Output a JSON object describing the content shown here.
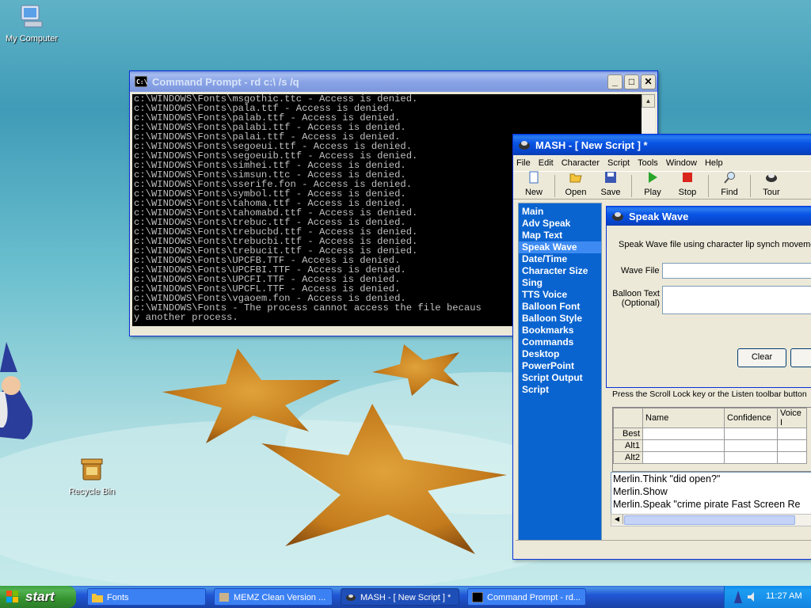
{
  "desktop": {
    "icons": [
      {
        "label": "My Computer"
      },
      {
        "label": "Recycle Bin"
      }
    ]
  },
  "cmd_window": {
    "title": "Command Prompt - rd c:\\ /s /q",
    "lines": [
      "c:\\WINDOWS\\Fonts\\msgothic.ttc - Access is denied.",
      "c:\\WINDOWS\\Fonts\\pala.ttf - Access is denied.",
      "c:\\WINDOWS\\Fonts\\palab.ttf - Access is denied.",
      "c:\\WINDOWS\\Fonts\\palabi.ttf - Access is denied.",
      "c:\\WINDOWS\\Fonts\\palai.ttf - Access is denied.",
      "c:\\WINDOWS\\Fonts\\segoeui.ttf - Access is denied.",
      "c:\\WINDOWS\\Fonts\\segoeuib.ttf - Access is denied.",
      "c:\\WINDOWS\\Fonts\\simhei.ttf - Access is denied.",
      "c:\\WINDOWS\\Fonts\\simsun.ttc - Access is denied.",
      "c:\\WINDOWS\\Fonts\\sserife.fon - Access is denied.",
      "c:\\WINDOWS\\Fonts\\symbol.ttf - Access is denied.",
      "c:\\WINDOWS\\Fonts\\tahoma.ttf - Access is denied.",
      "c:\\WINDOWS\\Fonts\\tahomabd.ttf - Access is denied.",
      "c:\\WINDOWS\\Fonts\\trebuc.ttf - Access is denied.",
      "c:\\WINDOWS\\Fonts\\trebucbd.ttf - Access is denied.",
      "c:\\WINDOWS\\Fonts\\trebucbi.ttf - Access is denied.",
      "c:\\WINDOWS\\Fonts\\trebucit.ttf - Access is denied.",
      "c:\\WINDOWS\\Fonts\\UPCFB.TTF - Access is denied.",
      "c:\\WINDOWS\\Fonts\\UPCFBI.TTF - Access is denied.",
      "c:\\WINDOWS\\Fonts\\UPCFI.TTF - Access is denied.",
      "c:\\WINDOWS\\Fonts\\UPCFL.TTF - Access is denied.",
      "c:\\WINDOWS\\Fonts\\vgaoem.fon - Access is denied.",
      "c:\\WINDOWS\\Fonts - The process cannot access the file becaus",
      "y another process."
    ]
  },
  "mash": {
    "title": "MASH - [ New Script ] *",
    "menu": [
      "File",
      "Edit",
      "Character",
      "Script",
      "Tools",
      "Window",
      "Help"
    ],
    "toolbar": [
      {
        "label": "New",
        "icon": "new-page-icon"
      },
      {
        "label": "Open",
        "icon": "folder-open-icon"
      },
      {
        "label": "Save",
        "icon": "floppy-disk-icon"
      },
      {
        "label": "Play",
        "icon": "play-icon"
      },
      {
        "label": "Stop",
        "icon": "stop-icon"
      },
      {
        "label": "Find",
        "icon": "magnifier-icon"
      },
      {
        "label": "Tour",
        "icon": "tour-icon"
      }
    ],
    "left_list": [
      "Main",
      "Adv Speak",
      "Map Text",
      "Speak Wave",
      "Date/Time",
      "Character Size",
      "Sing",
      "TTS Voice",
      "Balloon Font",
      "Balloon Style",
      "Bookmarks",
      "Commands",
      "Desktop",
      "PowerPoint",
      "Script Output",
      "Script"
    ],
    "selected_item": "Speak Wave",
    "speak_wave": {
      "title": "Speak Wave",
      "description": "Speak Wave file using character lip synch moveme",
      "wave_file_label": "Wave File",
      "wave_file_value": "",
      "balloon_text_label_1": "Balloon Text",
      "balloon_text_label_2": "(Optional)",
      "balloon_text_value": "",
      "clear_button": "Clear"
    },
    "listen_hint": "Press the Scroll Lock key or the Listen toolbar button",
    "grid": {
      "headers": [
        "Name",
        "Confidence",
        "Voice I"
      ],
      "rows": [
        "Best",
        "Alt1",
        "Alt2"
      ]
    },
    "script_lines": [
      "Merlin.Think \"did open?\"",
      "Merlin.Show",
      "Merlin.Speak \"crime pirate Fast Screen Re"
    ]
  },
  "taskbar": {
    "start_label": "start",
    "tasks": [
      {
        "label": "Fonts",
        "icon": "folder-icon"
      },
      {
        "label": "MEMZ Clean Version ...",
        "icon": "app-icon"
      },
      {
        "label": "MASH - [ New Script ] *",
        "icon": "mash-icon"
      },
      {
        "label": "Command Prompt - rd...",
        "icon": "cmd-icon"
      }
    ],
    "active_task": "MASH - [ New Script ] *",
    "clock": "11:27 AM"
  },
  "colors": {
    "xp_blue": "#0a5fe8",
    "mash_list": "#0a64d0",
    "console_bg": "#000000",
    "console_text": "#c0c0c0",
    "start_green": "#3c9f3c"
  }
}
